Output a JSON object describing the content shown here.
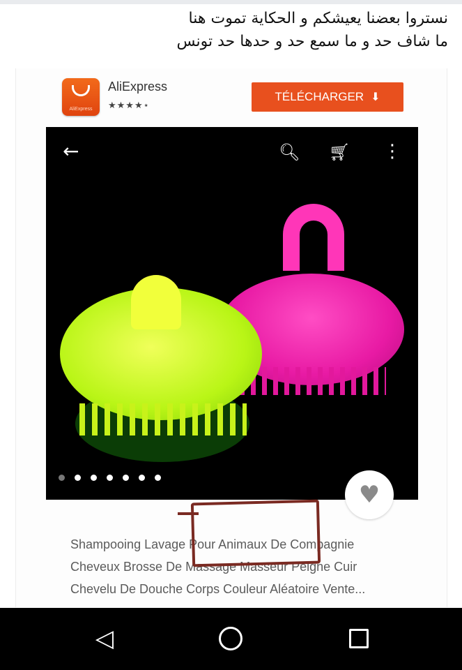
{
  "post": {
    "lines": [
      "نستروا بعضنا يعيشكم و الحكاية تموت هنا",
      "ما شاف حد و ما سمع حد و حدها حد تونس"
    ]
  },
  "app_banner": {
    "logo_icon": "aliexpress-logo-icon",
    "logo_caption": "AliExpress",
    "app_name": "AliExpress",
    "rating_stars": "★★★★⋆",
    "download_label": "TÉLÉCHARGER",
    "download_icon": "download-icon",
    "accent_color": "#e8501e"
  },
  "product_view": {
    "top_bar_icons": [
      "back-arrow-icon",
      "search-icon",
      "cart-icon",
      "more-vertical-icon"
    ],
    "image_subject": "pink and green silicone shampoo brushes",
    "carousel": {
      "total": 7,
      "active_index": 1
    },
    "wishlist_icon": "heart-icon"
  },
  "product_title": {
    "lines": [
      "Shampooing Lavage Pour Animaux De Compagnie",
      "Cheveux Brosse De Massage Masseur Peigne Cuir",
      "Chevelu De Douche Corps Couleur Aléatoire Vente..."
    ]
  },
  "annotation": {
    "color": "#7a2a22",
    "highlighted_text": "Pour Animaux De"
  },
  "android_nav": {
    "icons": [
      "nav-back-icon",
      "nav-home-icon",
      "nav-recents-icon"
    ]
  }
}
